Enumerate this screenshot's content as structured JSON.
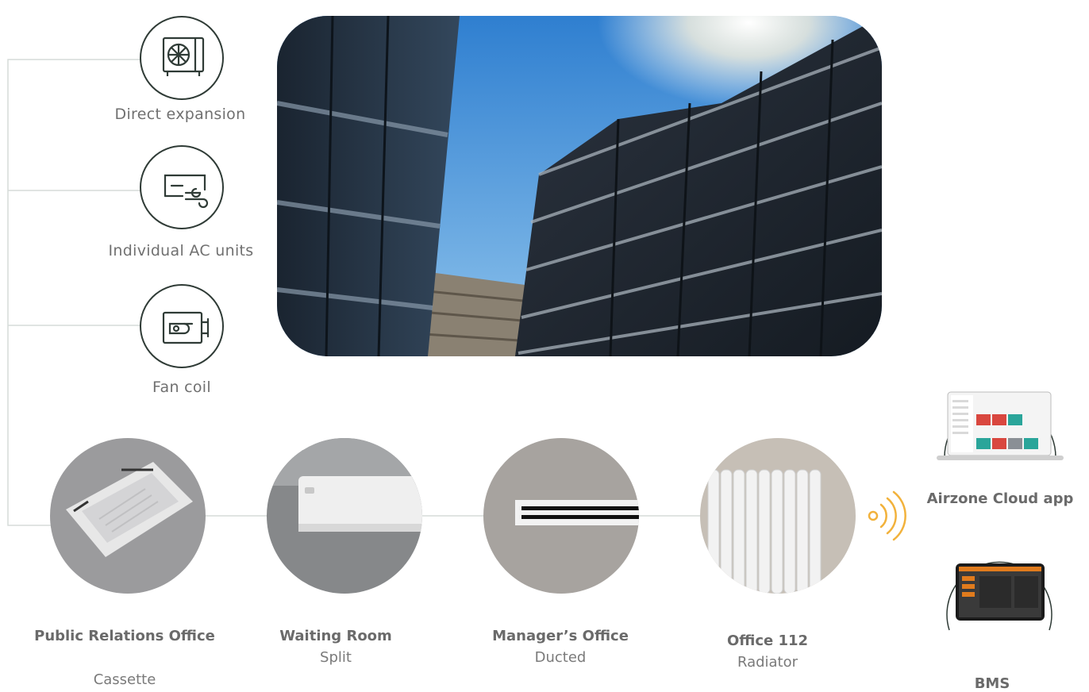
{
  "systems": [
    {
      "id": "direct-expansion",
      "label": "Direct expansion",
      "icon": "outdoor-unit-icon"
    },
    {
      "id": "individual-ac",
      "label": "Individual AC units",
      "icon": "split-ac-icon"
    },
    {
      "id": "fan-coil",
      "label": "Fan coil",
      "icon": "fan-coil-icon"
    }
  ],
  "rooms": [
    {
      "id": "public-relations",
      "name": "Public Relations Office",
      "type": "Cassette",
      "image": "cassette-unit-photo"
    },
    {
      "id": "waiting-room",
      "name": "Waiting Room",
      "type": "Split",
      "image": "split-unit-photo"
    },
    {
      "id": "managers-office",
      "name": "Manager’s Office",
      "type": "Ducted",
      "image": "duct-grille-photo"
    },
    {
      "id": "office-112",
      "name": "Office 112",
      "type": "Radiator",
      "image": "radiator-photo"
    }
  ],
  "controls": {
    "cloud_app": {
      "label": "Airzone Cloud app",
      "icon": "laptop-icon"
    },
    "bms": {
      "label": "BMS",
      "icon": "tablet-icon"
    },
    "signal": {
      "icon": "wireless-signal-icon",
      "color": "#f2b23c"
    }
  },
  "colors": {
    "line": "#d6dcd9",
    "icon_stroke": "#2f3b36",
    "text": "#6b6b6b",
    "signal": "#f2b23c"
  },
  "photo": {
    "subject": "office-buildings-photo"
  }
}
